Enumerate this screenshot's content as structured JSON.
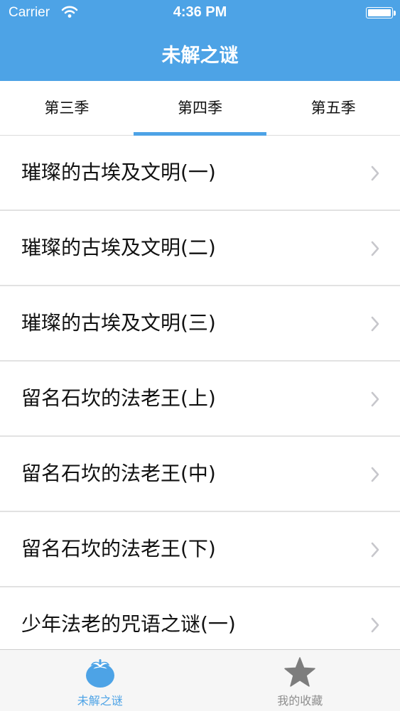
{
  "status_bar": {
    "carrier": "Carrier",
    "time": "4:36 PM",
    "icons": [
      "wifi-icon",
      "battery-icon"
    ]
  },
  "nav": {
    "title": "未解之谜"
  },
  "tabs": [
    {
      "label": "第三季",
      "active": false
    },
    {
      "label": "第四季",
      "active": true
    },
    {
      "label": "第五季",
      "active": false
    }
  ],
  "list": {
    "items": [
      {
        "label": "璀璨的古埃及文明(一)"
      },
      {
        "label": "璀璨的古埃及文明(二)"
      },
      {
        "label": "璀璨的古埃及文明(三)"
      },
      {
        "label": "留名石坎的法老王(上)"
      },
      {
        "label": "留名石坎的法老王(中)"
      },
      {
        "label": "留名石坎的法老王(下)"
      },
      {
        "label": "少年法老的咒语之谜(一)"
      }
    ],
    "row_icon": "chevron-right-icon"
  },
  "tabbar": {
    "items": [
      {
        "label": "未解之谜",
        "icon": "tomato-icon",
        "active": true
      },
      {
        "label": "我的收藏",
        "icon": "star-icon",
        "active": false
      }
    ]
  },
  "colors": {
    "accent": "#4da3e6",
    "chevron": "#c7c7cc",
    "tabbar_background": "#f6f6f6",
    "inactive_icon": "#7d7d7d"
  }
}
